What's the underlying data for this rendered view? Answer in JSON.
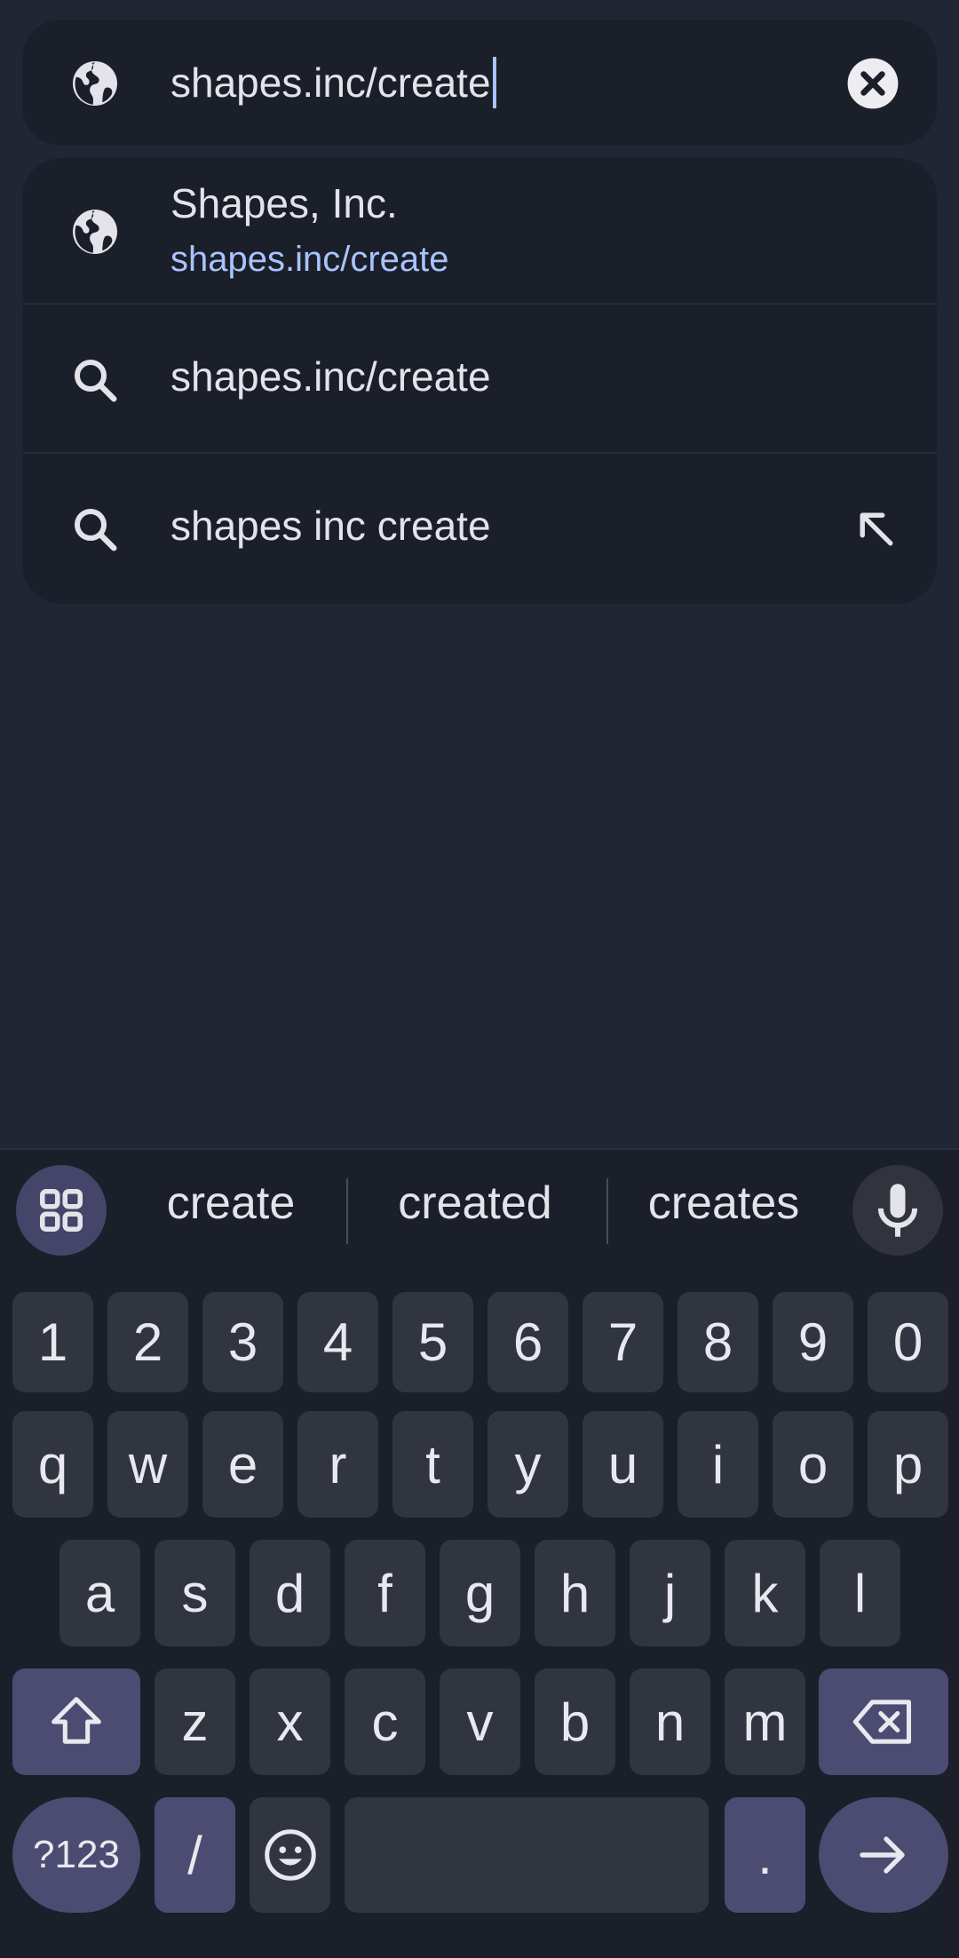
{
  "omnibox": {
    "url_text": "shapes.inc/create",
    "icons": {
      "left": "globe-icon",
      "clear": "clear-icon"
    }
  },
  "suggestions": [
    {
      "type": "site",
      "icon": "globe-icon",
      "title": "Shapes, Inc.",
      "url": "shapes.inc/create"
    },
    {
      "type": "search",
      "icon": "search-icon",
      "title": "shapes.inc/create"
    },
    {
      "type": "search",
      "icon": "search-icon",
      "title": "shapes inc create",
      "action_icon": "insert-arrow-icon"
    }
  ],
  "keyboard": {
    "word_suggestions": [
      "create",
      "created",
      "creates"
    ],
    "rows": {
      "numbers": [
        "1",
        "2",
        "3",
        "4",
        "5",
        "6",
        "7",
        "8",
        "9",
        "0"
      ],
      "row1": [
        "q",
        "w",
        "e",
        "r",
        "t",
        "y",
        "u",
        "i",
        "o",
        "p"
      ],
      "row2": [
        "a",
        "s",
        "d",
        "f",
        "g",
        "h",
        "j",
        "k",
        "l"
      ],
      "row3": [
        "z",
        "x",
        "c",
        "v",
        "b",
        "n",
        "m"
      ]
    },
    "symbols_label": "?123",
    "slash_label": "/",
    "period_label": ".",
    "colors": {
      "background": "#1b1f29",
      "key": "#31353f",
      "modifier_key": "#4c4b72",
      "accent_link": "#a9c3ff"
    }
  }
}
